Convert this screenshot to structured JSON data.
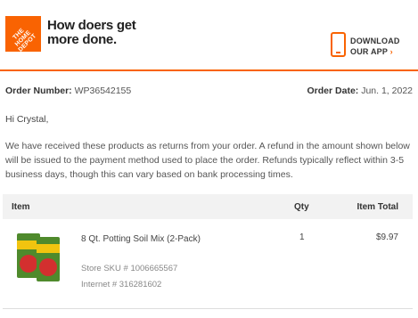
{
  "header": {
    "logo_text": "THE HOME DEPOT",
    "tagline": "How doers get more done.",
    "download_line1": "DOWNLOAD",
    "download_line2": "OUR APP",
    "chevron": "›",
    "accent_color": "#f96302"
  },
  "order": {
    "number_label": "Order Number:",
    "number_value": "WP36542155",
    "date_label": "Order Date:",
    "date_value": "Jun. 1, 2022"
  },
  "message": {
    "greeting": "Hi Crystal,",
    "body": "We have received these products as returns from your order. A refund in the amount shown below will be issued to the payment method used to place the order. Refunds typically reflect within 3-5 business days, though this can vary based on bank processing times."
  },
  "table": {
    "col_item": "Item",
    "col_qty": "Qty",
    "col_total": "Item Total",
    "rows": [
      {
        "name": "8 Qt. Potting Soil Mix (2-Pack)",
        "qty": "1",
        "total": "$9.97",
        "sku": "Store SKU # 1006665567",
        "internet": "Internet # 316281602",
        "image_icon": "potting-soil-bags"
      }
    ]
  }
}
